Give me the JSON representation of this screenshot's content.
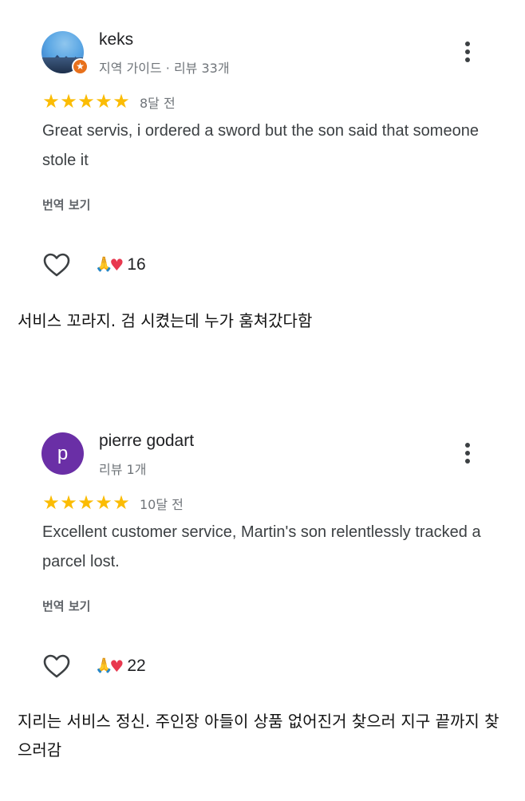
{
  "reviews": [
    {
      "name": "keks",
      "meta": "지역 가이드 · 리뷰 33개",
      "rating": 5,
      "when": "8달 전",
      "text": "Great servis, i ordered a sword but the son said that someone stole it",
      "translate_label": "번역 보기",
      "reaction_count": "16",
      "avatar": "landscape-photo",
      "badge_icon": "local-guide-star-icon"
    },
    {
      "name": "pierre godart",
      "meta": "리뷰 1개",
      "rating": 5,
      "when": "10달 전",
      "text": "Excellent customer service, Martin's son relentlessly tracked a parcel lost.",
      "translate_label": "번역 보기",
      "reaction_count": "22",
      "avatar_letter": "p",
      "avatar_color": "#6a2fa6"
    }
  ],
  "captions": [
    "서비스 꼬라지. 검 시켰는데 누가 훔쳐갔다함",
    "지리는 서비스 정신. 주인장 아들이 상품 없어진거 찾으러 지구 끝까지 찾으러감"
  ],
  "colors": {
    "star": "#fbbc04",
    "badge": "#e8711c",
    "heart": "#e8384f"
  }
}
